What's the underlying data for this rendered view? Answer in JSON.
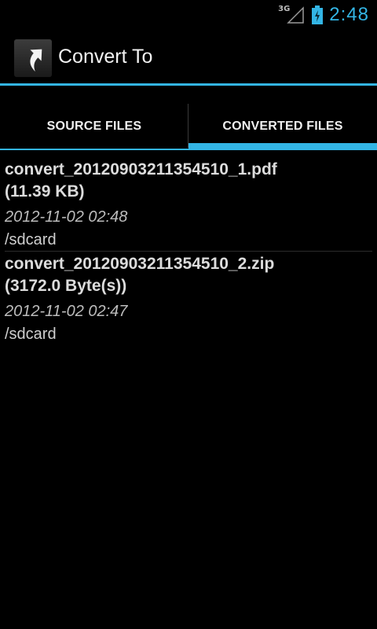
{
  "status_bar": {
    "network": "3G",
    "time": "2:48",
    "accent_color": "#33b5e5"
  },
  "action_bar": {
    "title": "Convert To",
    "icon": "share-arrow-icon"
  },
  "tabs": [
    {
      "label": "SOURCE FILES",
      "selected": false
    },
    {
      "label": "CONVERTED FILES",
      "selected": true
    }
  ],
  "files": [
    {
      "name": "convert_20120903211354510_1.pdf",
      "size": "(11.39 KB)",
      "date": "2012-11-02 02:48",
      "path": "/sdcard"
    },
    {
      "name": "convert_20120903211354510_2.zip",
      "size": "(3172.0 Byte(s))",
      "date": "2012-11-02 02:47",
      "path": "/sdcard"
    }
  ]
}
